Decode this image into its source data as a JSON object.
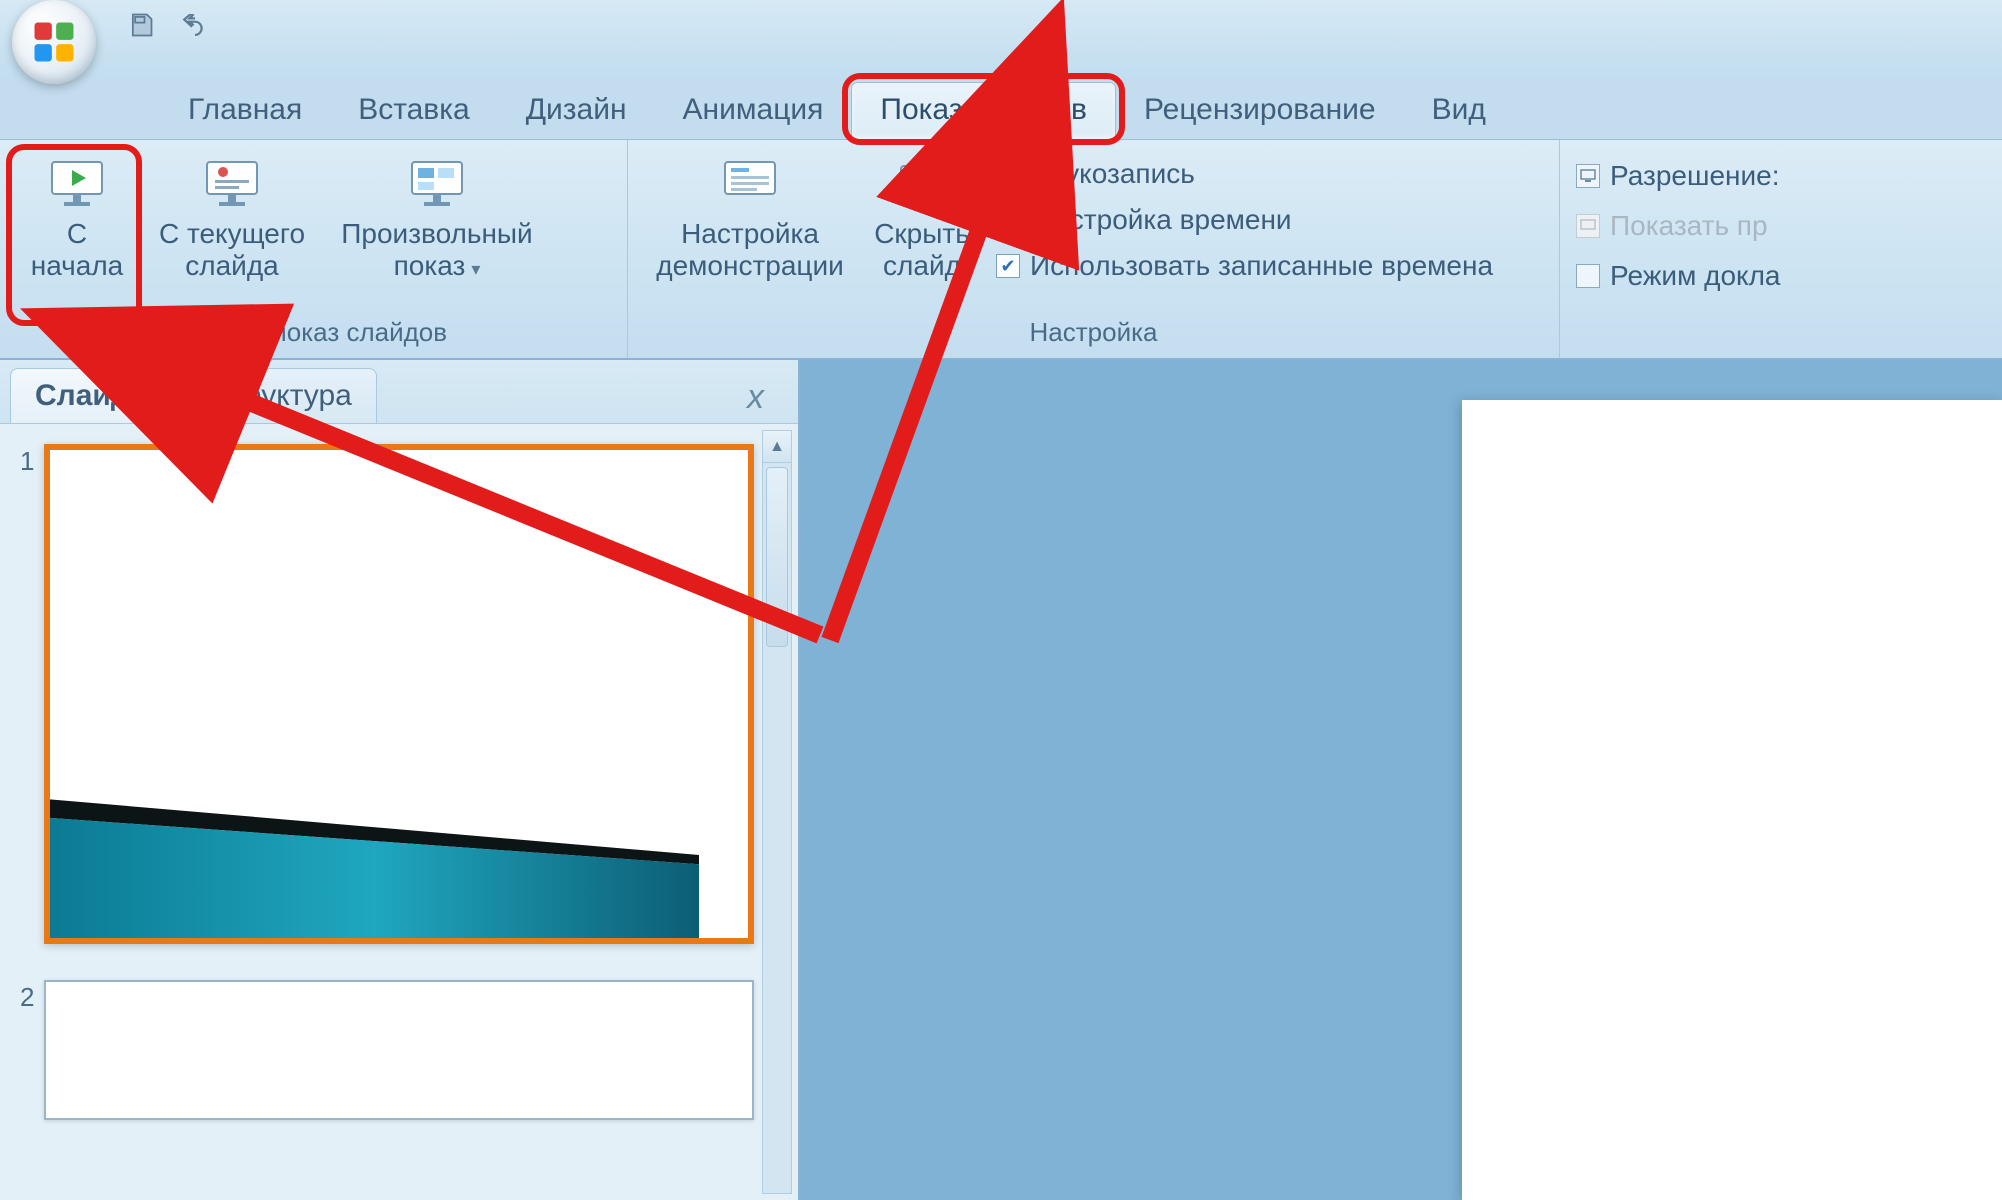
{
  "tabs": {
    "items": [
      {
        "label": "Главная"
      },
      {
        "label": "Вставка"
      },
      {
        "label": "Дизайн"
      },
      {
        "label": "Анимация"
      },
      {
        "label": "Показ слайдов"
      },
      {
        "label": "Рецензирование"
      },
      {
        "label": "Вид"
      }
    ],
    "active_index": 4
  },
  "ribbon": {
    "group_start": {
      "label": "Начать показ слайдов",
      "from_beginning_line1": "С",
      "from_beginning_line2": "начала",
      "from_current_line1": "С текущего",
      "from_current_line2": "слайда",
      "custom_line1": "Произвольный",
      "custom_line2": "показ"
    },
    "group_setup": {
      "label": "Настройка",
      "setup_line1": "Настройка",
      "setup_line2": "демонстрации",
      "hide_line1": "Скрыть",
      "hide_line2": "слайд",
      "record": "Звукозапись",
      "rehearse": "Настройка времени",
      "use_timings": "Использовать записанные времена",
      "use_timings_checked": true
    },
    "group_monitors": {
      "resolution": "Разрешение:",
      "show_on": "Показать пр",
      "presenter_view": "Режим докла"
    }
  },
  "side_panel": {
    "tab_slides": "Слайды",
    "tab_outline": "Структура",
    "slides": [
      {
        "num": "1"
      },
      {
        "num": "2"
      }
    ]
  }
}
